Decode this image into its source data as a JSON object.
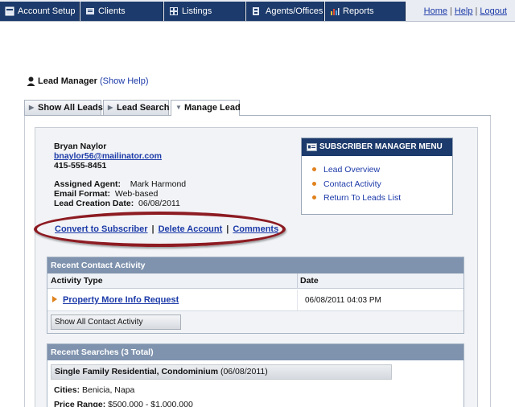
{
  "nav": {
    "tabs": [
      {
        "label": "Account Setup",
        "icon": "account-setup-icon"
      },
      {
        "label": "Clients",
        "icon": "clients-icon"
      },
      {
        "label": "Listings",
        "icon": "listings-icon"
      },
      {
        "label": "Agents/Offices",
        "icon": "agents-icon"
      },
      {
        "label": "Reports",
        "icon": "reports-icon"
      }
    ],
    "links": {
      "home": "Home",
      "help": "Help",
      "logout": "Logout",
      "sep": "|"
    }
  },
  "page": {
    "title": "Lead Manager",
    "show_help": "(Show Help)"
  },
  "tabs": [
    {
      "label": "Show All Leads"
    },
    {
      "label": "Lead Search"
    },
    {
      "label": "Manage Lead"
    }
  ],
  "lead": {
    "name": "Bryan Naylor",
    "email": "bnaylor56@mailinator.com",
    "phone": "415-555-8451",
    "assigned_agent_label": "Assigned Agent:",
    "assigned_agent": "Mark Harmond",
    "email_format_label": "Email Format:",
    "email_format": "Web-based",
    "creation_date_label": "Lead Creation Date:",
    "creation_date": "06/08/2011"
  },
  "submenu": {
    "title": "SUBSCRIBER MANAGER MENU",
    "items": [
      "Lead Overview",
      "Contact Activity",
      "Return To Leads List"
    ]
  },
  "actions": {
    "convert": "Convert to Subscriber",
    "delete": "Delete Account",
    "comments": "Comments",
    "sep": "|"
  },
  "contact_activity": {
    "title": "Recent Contact Activity",
    "columns": [
      "Activity Type",
      "Date"
    ],
    "rows": [
      {
        "type": "Property More Info Request",
        "date": "06/08/2011 04:03 PM"
      }
    ],
    "show_all_button": "Show All Contact Activity"
  },
  "recent_searches": {
    "title": "Recent Searches (3 Total)",
    "search_name": "Single Family Residential, Condominium",
    "search_date": "(06/08/2011)",
    "cities_label": "Cities:",
    "cities": "Benicia, Napa",
    "price_label": "Price Range:",
    "price": "$500,000 - $1,000,000"
  },
  "colors": {
    "nav_bg": "#1c3a6b",
    "link": "#1c3aa8",
    "section_header": "#7f93ae",
    "highlight_ellipse": "#8d1b22",
    "bullet": "#e0811c"
  }
}
